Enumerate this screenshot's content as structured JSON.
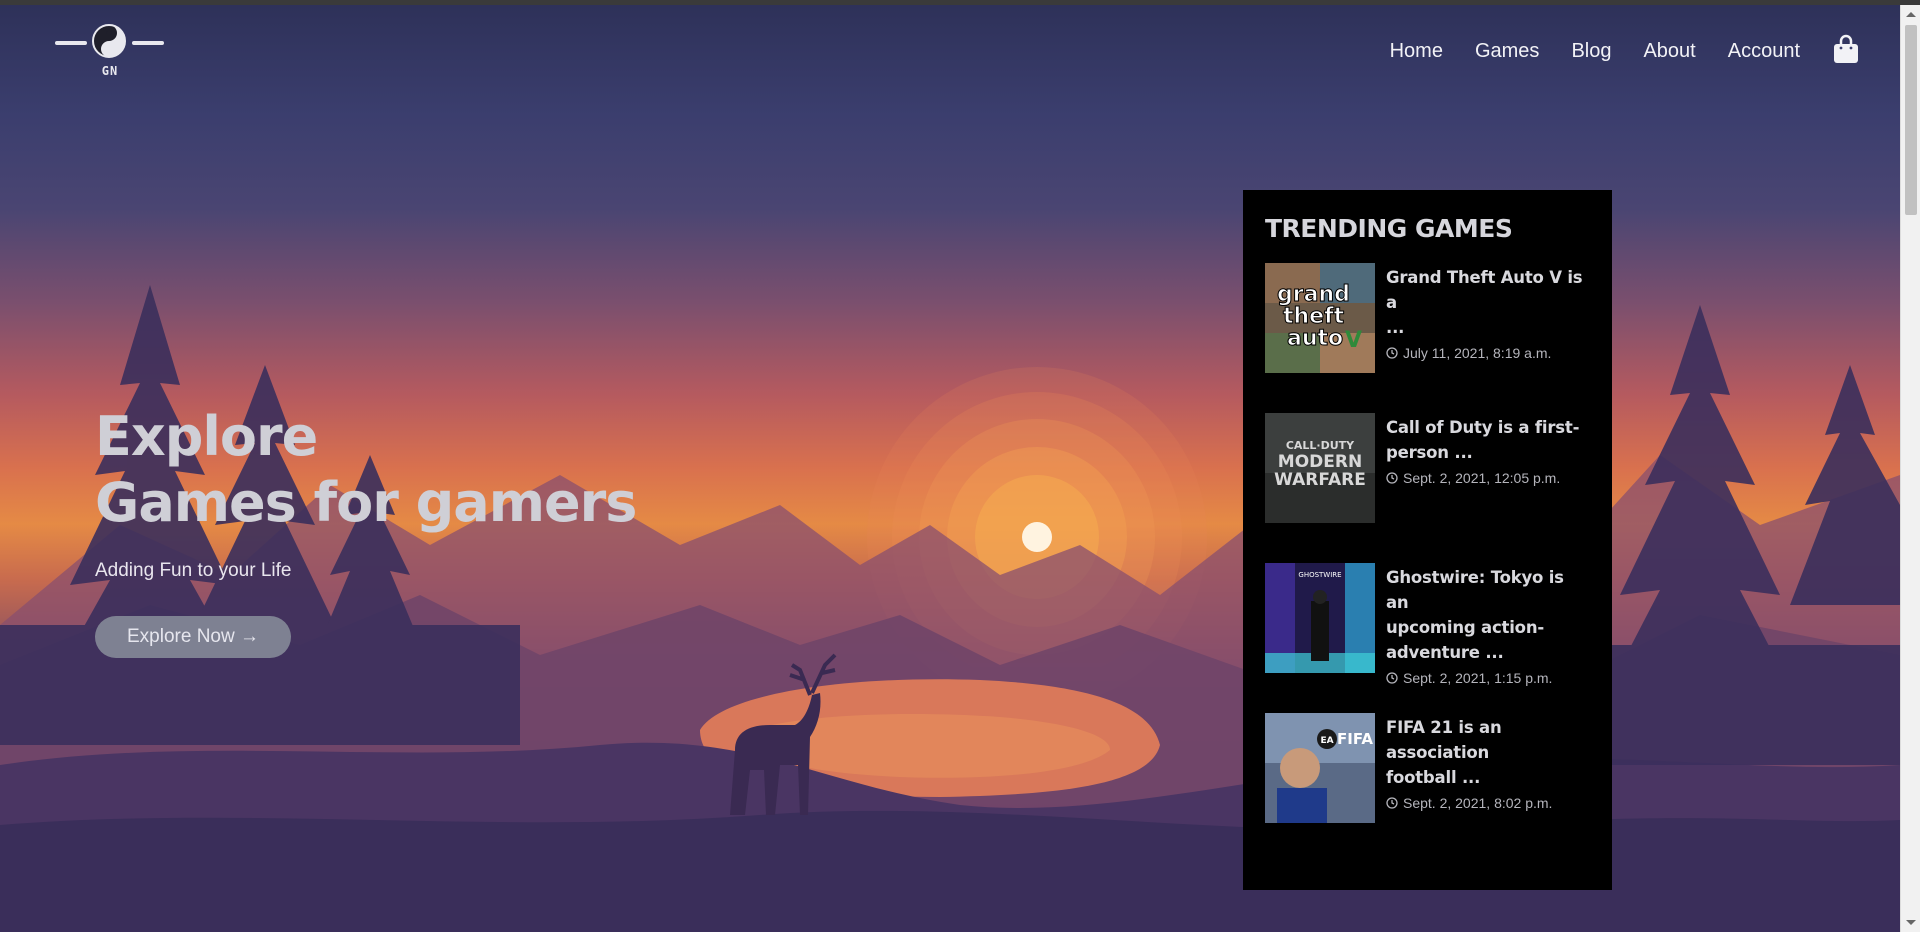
{
  "logo": {
    "text": "GN"
  },
  "nav": [
    {
      "label": "Home"
    },
    {
      "label": "Games"
    },
    {
      "label": "Blog"
    },
    {
      "label": "About"
    },
    {
      "label": "Account"
    }
  ],
  "hero": {
    "title_line1": "Explore",
    "title_line2": "Games for gamers",
    "subtitle": "Adding Fun to your Life",
    "button_label": "Explore Now →"
  },
  "trending": {
    "heading": "TRENDING GAMES",
    "items": [
      {
        "title_line1": "Grand Theft Auto V is a",
        "title_line2": "...",
        "title_line3": "",
        "date": "July 11, 2021, 8:19 a.m.",
        "thumb": "gta-v-cover"
      },
      {
        "title_line1": "Call of Duty is a first-",
        "title_line2": "person ...",
        "title_line3": "",
        "date": "Sept. 2, 2021, 12:05 p.m.",
        "thumb": "cod-modern-warfare-cover"
      },
      {
        "title_line1": "Ghostwire: Tokyo is an",
        "title_line2": "upcoming action-",
        "title_line3": "adventure ...",
        "date": "Sept. 2, 2021, 1:15 p.m.",
        "thumb": "ghostwire-tokyo-cover"
      },
      {
        "title_line1": "FIFA 21 is an association",
        "title_line2": "football ...",
        "title_line3": "",
        "date": "Sept. 2, 2021, 8:02 p.m.",
        "thumb": "fifa-21-cover"
      }
    ]
  },
  "thumb_text": {
    "gta": [
      "grand",
      "theft",
      "auto",
      "V"
    ],
    "cod": [
      "CALL·DUTY",
      "MODERN",
      "WARFARE"
    ],
    "ghostwire": "GHOSTWIRE",
    "fifa": [
      "EA",
      "FIFA"
    ]
  },
  "colors": {
    "accent_button": "#7e8192",
    "panel": "#000000",
    "sun": "#fff3e0"
  },
  "icons": {
    "cart": "shopping-bag-icon",
    "clock": "clock-icon",
    "logo": "yin-yang-icon"
  }
}
